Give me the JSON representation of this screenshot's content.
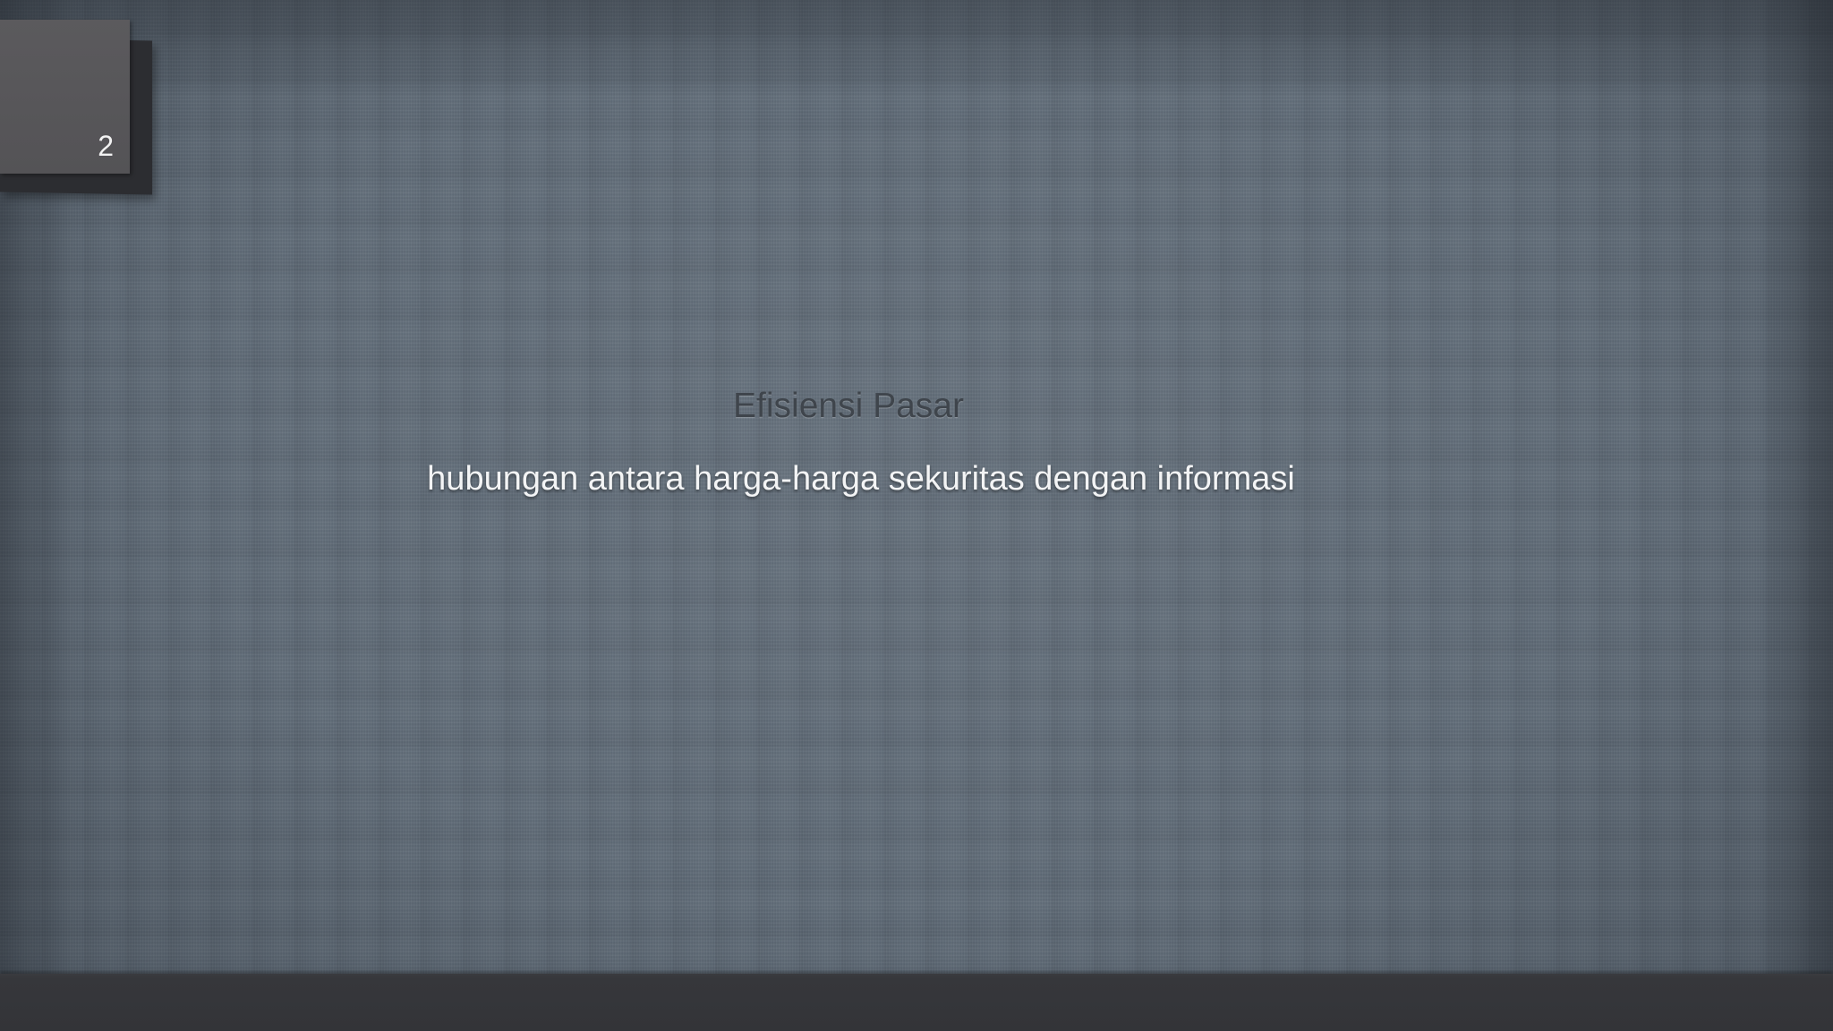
{
  "slide": {
    "number": "2",
    "title": "Efisiensi Pasar",
    "subtitle": "hubungan antara harga-harga sekuritas dengan informasi"
  },
  "colors": {
    "background": "#5e6a76",
    "footer_bar": "#36373b",
    "number_card": "#58575a",
    "title_text": "#3f454c",
    "subtitle_text": "#f3f4f5"
  }
}
